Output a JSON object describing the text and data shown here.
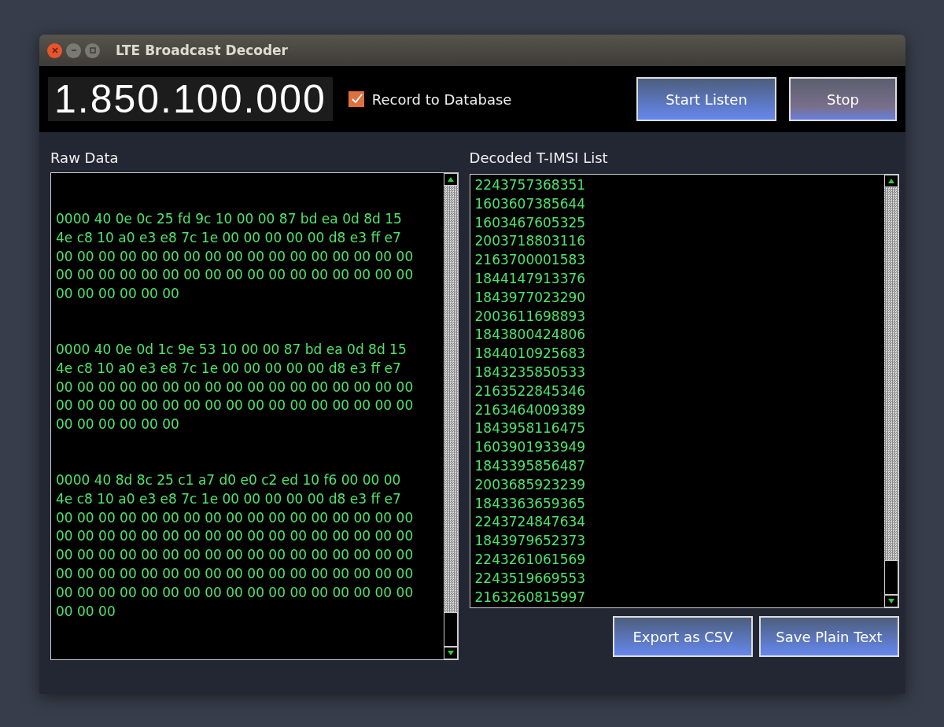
{
  "window": {
    "title": "LTE Broadcast Decoder"
  },
  "toolbar": {
    "frequency": "1.850.100.000",
    "record_checkbox": {
      "label": "Record to Database",
      "checked": true
    },
    "buttons": [
      {
        "label": "Start Listen",
        "kind": "start"
      },
      {
        "label": "Stop",
        "kind": "stop"
      }
    ]
  },
  "raw_data": {
    "title": "Raw Data",
    "packets": [
      {
        "lines": [
          "0000 40 0e 0c 25 fd 9c 10 00 00 87 bd ea 0d 8d 15",
          "4e c8 10 a0 e3 e8 7c 1e 00 00 00 00 00 d8 e3 ff e7",
          "00 00 00 00 00 00 00 00 00 00 00 00 00 00 00 00 00",
          "00 00 00 00 00 00 00 00 00 00 00 00 00 00 00 00 00",
          "00 00 00 00 00 00"
        ]
      },
      {
        "lines": [
          "0000 40 0e 0d 1c 9e 53 10 00 00 87 bd ea 0d 8d 15",
          "4e c8 10 a0 e3 e8 7c 1e 00 00 00 00 00 d8 e3 ff e7",
          "00 00 00 00 00 00 00 00 00 00 00 00 00 00 00 00 00",
          "00 00 00 00 00 00 00 00 00 00 00 00 00 00 00 00 00",
          "00 00 00 00 00 00"
        ]
      },
      {
        "lines": [
          "0000 40 8d 8c 25 c1 a7 d0 e0 c2 ed 10 f6 00 00 00",
          "4e c8 10 a0 e3 e8 7c 1e 00 00 00 00 00 d8 e3 ff e7",
          "00 00 00 00 00 00 00 00 00 00 00 00 00 00 00 00 00",
          "00 00 00 00 00 00 00 00 00 00 00 00 00 00 00 00 00",
          "00 00 00 00 00 00 00 00 00 00 00 00 00 00 00 00 00",
          "00 00 00 00 00 00 00 00 00 00 00 00 00 00 00 00 00",
          "00 00 00 00 00 00 00 00 00 00 00 00 00 00 00 00 00",
          "00 00 00"
        ]
      }
    ]
  },
  "decoded": {
    "title": "Decoded T-IMSI List",
    "items": [
      "2243757368351",
      "1603607385644",
      "1603467605325",
      "2003718803116",
      "2163700001583",
      "1844147913376",
      "1843977023290",
      "2003611698893",
      "1843800424806",
      "1844010925683",
      "1843235850533",
      "2163522845346",
      "2163464009389",
      "1843958116475",
      "1603901933949",
      "1843395856487",
      "2003685923239",
      "1843363659365",
      "2243724847634",
      "1843979652373",
      "2243261061569",
      "2243519669553",
      "2163260815997"
    ]
  },
  "footer_buttons": [
    "Export as CSV",
    "Save Plain Text"
  ]
}
